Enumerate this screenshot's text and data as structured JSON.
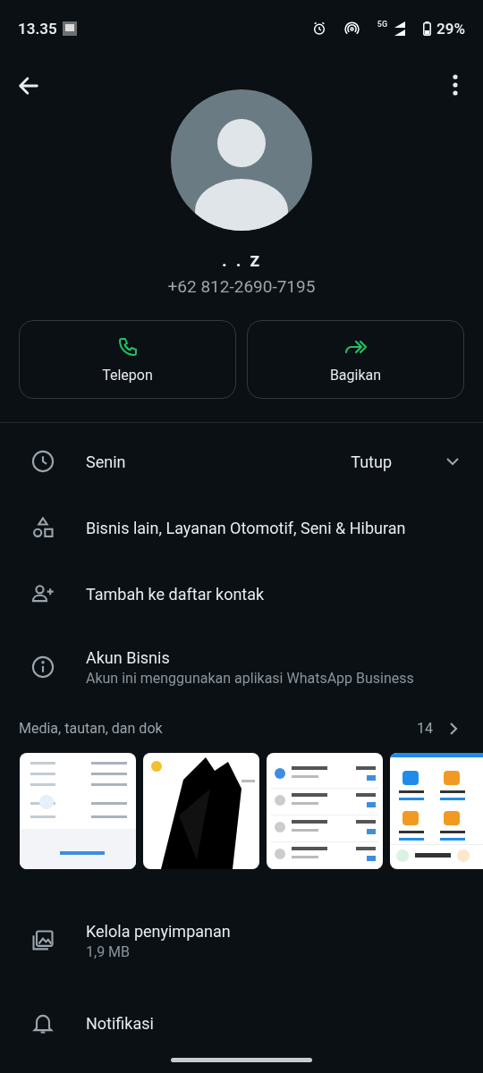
{
  "status_bar": {
    "time": "13.35",
    "network": "5G",
    "battery": "29%"
  },
  "profile": {
    "name": ". . z",
    "phone": "+62 812-2690-7195"
  },
  "actions": [
    {
      "kind": "call",
      "label": "Telepon"
    },
    {
      "kind": "share",
      "label": "Bagikan"
    }
  ],
  "hours": {
    "day": "Senin",
    "status": "Tutup",
    "expanded": false
  },
  "info_rows": [
    {
      "kind": "category",
      "title": "Bisnis lain, Layanan Otomotif, Seni & Hiburan"
    },
    {
      "kind": "add_contact",
      "title": "Tambah ke daftar kontak"
    },
    {
      "kind": "business",
      "title": "Akun Bisnis",
      "subtitle": "Akun ini menggunakan aplikasi WhatsApp Business"
    }
  ],
  "media": {
    "title": "Media, tautan, dan dok",
    "count": "14"
  },
  "settings": [
    {
      "kind": "storage",
      "title": "Kelola penyimpanan",
      "subtitle": "1,9 MB"
    },
    {
      "kind": "notification",
      "title": "Notifikasi"
    }
  ]
}
